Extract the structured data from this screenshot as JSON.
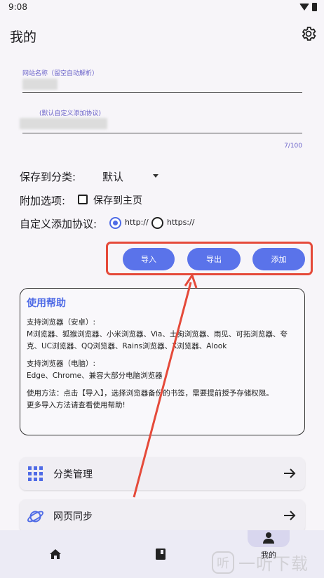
{
  "status": {
    "time": "9:08"
  },
  "header": {
    "title": "我的"
  },
  "form": {
    "url_label": "网站名称（留空自动解析）",
    "protocol_label": "(默认自定义添加协议)",
    "counter": "7/100",
    "category_label": "保存到分类:",
    "category_value": "默认",
    "extra_label": "附加选项:",
    "extra_checkbox": "保存到主页",
    "protocol_row_label": "自定义添加协议:",
    "protocol_http": "http://",
    "protocol_https": "https://"
  },
  "actions": {
    "import": "导入",
    "export": "导出",
    "add": "添加"
  },
  "help": {
    "title": "使用帮助",
    "p1": "支持浏览器（安卓）:\nM浏览器、狐猴浏览器、小米浏览器、Via、土狗浏览器、雨见、可拓浏览器、夸克、UC浏览器、QQ浏览器、Rains浏览器、X浏览器、Alook",
    "p2": "支持浏览器（电脑）:\nEdge、Chrome、兼容大部分电脑浏览器",
    "p3": "使用方法：点击【导入】，选择浏览器备份的书签，需要提前授予存储权限。\n更多导入方法请查看使用帮助!"
  },
  "menu": {
    "category_manage": "分类管理",
    "web_sync": "网页同步"
  },
  "nav": {
    "mine": "我的"
  },
  "watermark": {
    "logo": "听",
    "text": "一听下载"
  },
  "colors": {
    "accent": "#5a73ea",
    "highlight": "#e54a3a"
  }
}
